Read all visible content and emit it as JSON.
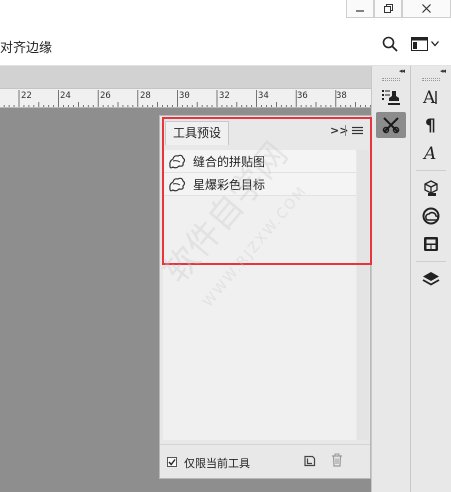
{
  "options_bar": {
    "label": "对齐边缘"
  },
  "ruler": {
    "ticks": [
      "22",
      "24",
      "26",
      "28",
      "30",
      "32",
      "34",
      "36",
      "38"
    ]
  },
  "tool_presets_panel": {
    "tab_label": "工具预设",
    "more_glyph": ">>",
    "items": [
      {
        "label": "缝合的拼贴图",
        "icon": "preset-tool-icon"
      },
      {
        "label": "星爆彩色目标",
        "icon": "preset-tool-icon"
      }
    ],
    "footer": {
      "current_tool_only_label": "仅限当前工具",
      "current_tool_only_checked": true
    }
  },
  "watermark": {
    "text": "软件自学网",
    "url": "WWW.RJZXW.COM"
  },
  "colors": {
    "highlight": "#e8343c",
    "canvas": "#8e8e8e",
    "panel_bg": "#e8e8e8",
    "active_dock_button": "#8c8c8c"
  },
  "icons": {
    "dock1": [
      "properties-stamp-icon",
      "tool-presets-icon"
    ],
    "dock2": [
      "character-icon",
      "paragraph-icon",
      "glyphs-icon",
      "3d-icon",
      "creative-cloud-libraries-icon",
      "navigator-icon",
      "layers-icon"
    ]
  }
}
